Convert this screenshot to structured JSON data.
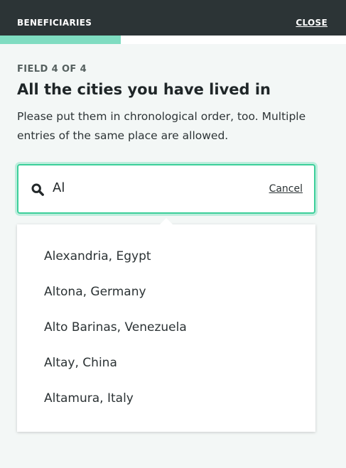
{
  "header": {
    "title": "BENEFICIARIES",
    "close_label": "CLOSE"
  },
  "progress": {
    "fraction": 0.35,
    "color": "#7fdcc1"
  },
  "form": {
    "counter": "FIELD 4 OF 4",
    "title": "All the cities you have lived in",
    "description": "Please put them in chronological order, too. Multiple entries of the same place are allowed."
  },
  "search": {
    "icon": "search-icon",
    "value": "Al",
    "cancel_label": "Cancel",
    "accent_color": "#3ccf9a"
  },
  "suggestions": [
    {
      "label": "Alexandria, Egypt"
    },
    {
      "label": "Altona, Germany"
    },
    {
      "label": "Alto Barinas, Venezuela"
    },
    {
      "label": "Altay, China"
    },
    {
      "label": "Altamura, Italy"
    }
  ]
}
